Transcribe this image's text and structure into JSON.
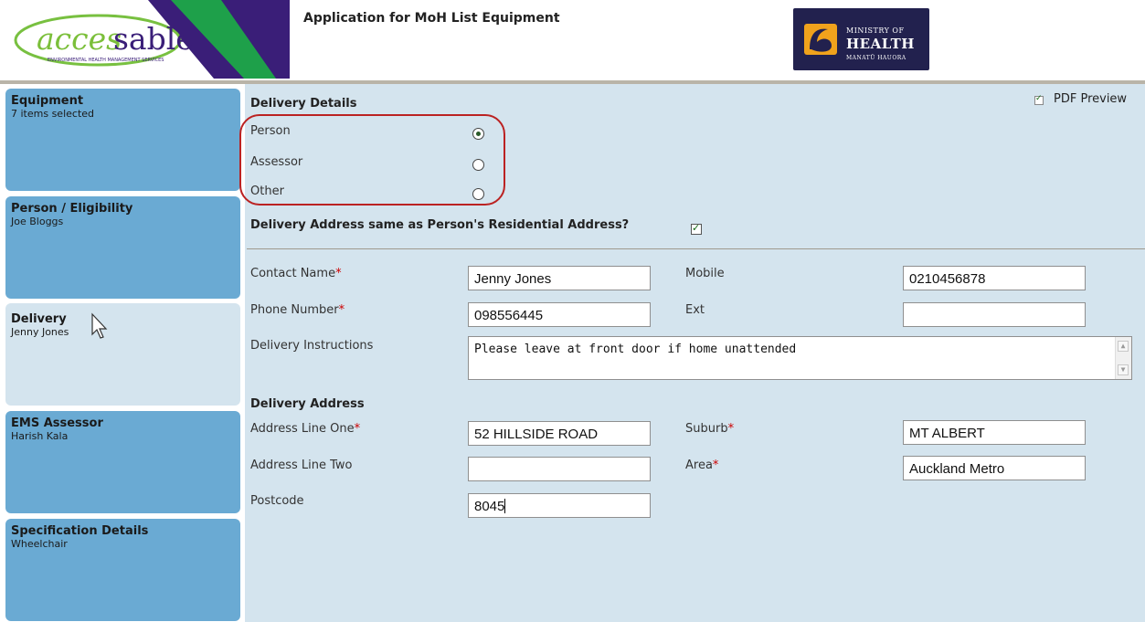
{
  "header": {
    "brand_logo_text": "accessable",
    "brand_logo_tagline": "ENVIRONMENTAL HEALTH MANAGEMENT SERVICES",
    "app_title": "Application for MoH List Equipment",
    "moh_logo": {
      "line1": "MINISTRY OF",
      "line2": "HEALTH",
      "line3": "MANATŪ HAUORA"
    }
  },
  "sidebar": {
    "items": [
      {
        "title": "Equipment",
        "subtitle": "7 items selected",
        "active": false
      },
      {
        "title": "Person / Eligibility",
        "subtitle": "Joe Bloggs",
        "active": false
      },
      {
        "title": "Delivery",
        "subtitle": "Jenny Jones",
        "active": true
      },
      {
        "title": "EMS Assessor",
        "subtitle": "Harish Kala",
        "active": false
      },
      {
        "title": "Specification Details",
        "subtitle": "Wheelchair",
        "active": false
      }
    ]
  },
  "pdf_preview": {
    "label": "PDF Preview",
    "checked": true
  },
  "delivery_details": {
    "heading": "Delivery Details",
    "options": [
      {
        "label": "Person",
        "selected": true
      },
      {
        "label": "Assessor",
        "selected": false
      },
      {
        "label": "Other",
        "selected": false
      }
    ],
    "same_address_label": "Delivery Address same as Person's Residential Address?",
    "same_address_checked": true
  },
  "contact": {
    "contact_name_label": "Contact Name",
    "contact_name_value": "Jenny Jones",
    "mobile_label": "Mobile",
    "mobile_value": "0210456878",
    "phone_label": "Phone Number",
    "phone_value": "098556445",
    "ext_label": "Ext",
    "ext_value": "",
    "instructions_label": "Delivery Instructions",
    "instructions_value": "Please leave at front door if home unattended"
  },
  "delivery_address": {
    "heading": "Delivery Address",
    "line_one_label": "Address Line One",
    "line_one_value": "52 HILLSIDE ROAD",
    "suburb_label": "Suburb",
    "suburb_value": "MT ALBERT",
    "line_two_label": "Address Line Two",
    "line_two_value": "",
    "area_label": "Area",
    "area_value": "Auckland Metro",
    "postcode_label": "Postcode",
    "postcode_value": "8045"
  },
  "colors": {
    "panel_bg": "#d4e4ee",
    "sidebar_item": "#6aaad3",
    "required_marker": "#cc0000",
    "highlight_oval": "#b22222"
  },
  "required_marker": "*"
}
